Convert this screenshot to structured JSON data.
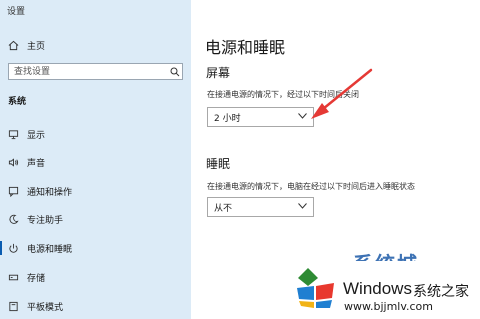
{
  "app_title": "设置",
  "sidebar": {
    "home_label": "主页",
    "search_placeholder": "查找设置",
    "section_label": "系统",
    "items": [
      {
        "label": "显示",
        "icon": "display-icon"
      },
      {
        "label": "声音",
        "icon": "speaker-icon"
      },
      {
        "label": "通知和操作",
        "icon": "notification-icon"
      },
      {
        "label": "专注助手",
        "icon": "moon-icon"
      },
      {
        "label": "电源和睡眠",
        "icon": "power-icon",
        "active": true
      },
      {
        "label": "存储",
        "icon": "storage-icon"
      },
      {
        "label": "平板模式",
        "icon": "tablet-icon"
      }
    ]
  },
  "main": {
    "title": "电源和睡眠",
    "screen": {
      "heading": "屏幕",
      "description": "在接通电源的情况下，经过以下时间后关闭",
      "selected": "2 小时"
    },
    "sleep": {
      "heading": "睡眠",
      "description": "在接通电源的情况下，电脑在经过以下时间后进入睡眠状态",
      "selected": "从不"
    }
  },
  "watermark": {
    "partial_text": "系统城",
    "brand": "Windows",
    "brand_cn": "系统之家",
    "url": "www.bjjmlv.com"
  },
  "colors": {
    "sidebar_bg": "#dcebf7",
    "annotation_arrow": "#e53935",
    "accent": "#0a5cb0"
  }
}
